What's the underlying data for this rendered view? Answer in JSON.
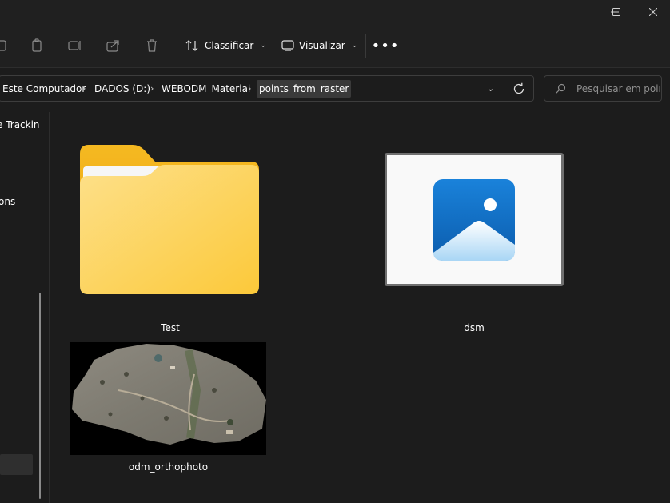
{
  "window": {
    "controls": [
      "minimize-icon",
      "maximize-icon",
      "close-icon"
    ]
  },
  "toolbar": {
    "sort_label": "Classificar",
    "view_label": "Visualizar",
    "more_label": "•••"
  },
  "address": {
    "crumbs": [
      "Este Computador",
      "DADOS (D:)",
      "WEBODM_Material",
      "points_from_raster"
    ]
  },
  "search": {
    "placeholder": "Pesquisar em poin..."
  },
  "sidebar": {
    "items": [
      {
        "label": "e Trackin"
      },
      {
        "label": "ons"
      }
    ]
  },
  "files": [
    {
      "name": "Test",
      "type": "folder"
    },
    {
      "name": "dsm",
      "type": "image"
    },
    {
      "name": "odm_orthophoto",
      "type": "image"
    }
  ],
  "colors": {
    "background": "#1c1c1c",
    "chrome": "#202020",
    "folder_back": "#f0b429",
    "folder_front": "#fcd66a",
    "image_icon_blue": "#1677d2"
  }
}
